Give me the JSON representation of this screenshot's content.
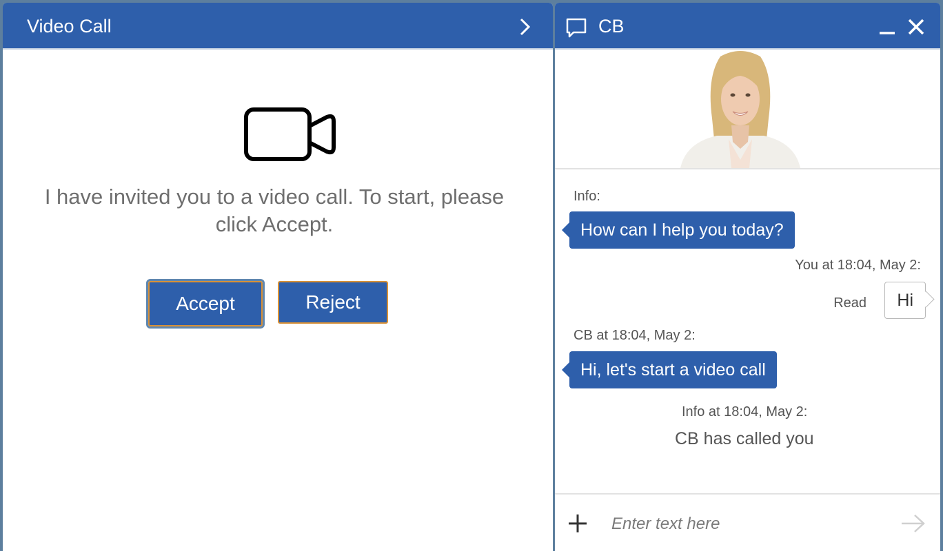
{
  "video_panel": {
    "title": "Video Call",
    "invite_text": "I have invited you to a video call. To start, please click Accept.",
    "accept_label": "Accept",
    "reject_label": "Reject"
  },
  "chat_panel": {
    "title": "CB",
    "messages": [
      {
        "meta": "Info:",
        "text": "How can I help you today?",
        "direction": "incoming"
      },
      {
        "meta": "You at 18:04, May 2:",
        "text": "Hi",
        "status": "Read",
        "direction": "outgoing"
      },
      {
        "meta": "CB at 18:04, May 2:",
        "text": "Hi, let's start a video call",
        "direction": "incoming"
      },
      {
        "meta": "Info at 18:04, May 2:",
        "text": "CB has called you",
        "direction": "system"
      }
    ],
    "input_placeholder": "Enter text here"
  },
  "colors": {
    "header": "#2e5fab",
    "button_border": "#d89137",
    "background": "#5d7f9e"
  },
  "icons": [
    "chevron-right-icon",
    "chat-bubble-icon",
    "minimize-icon",
    "close-icon",
    "video-camera-icon",
    "plus-icon",
    "send-arrow-icon"
  ]
}
